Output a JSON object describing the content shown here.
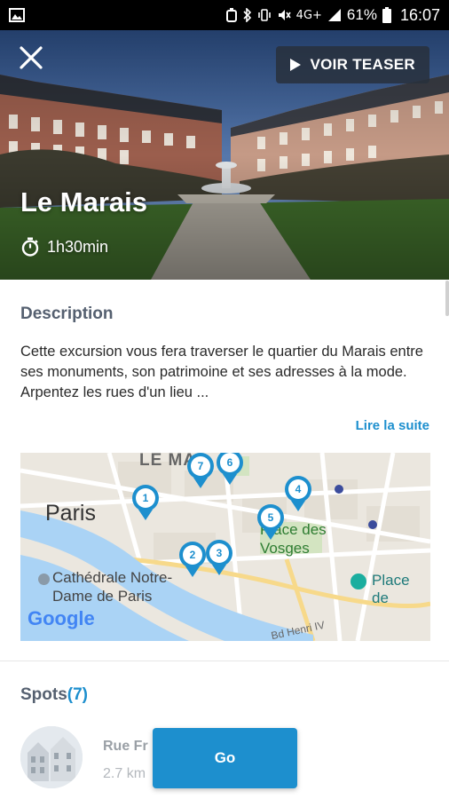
{
  "status_bar": {
    "battery": "61%",
    "time": "16:07",
    "network": "4G+",
    "icons": [
      "image-icon",
      "alarm-icon",
      "bluetooth-icon",
      "vibrate-icon",
      "mute-icon",
      "signal-icon",
      "battery-icon"
    ]
  },
  "hero": {
    "title": "Le Marais",
    "duration": "1h30min",
    "teaser_label": "VOIR TEASER",
    "close_icon": "close-icon",
    "timer_icon": "stopwatch-icon"
  },
  "description": {
    "heading": "Description",
    "text": "Cette excursion vous fera traverser le quartier du Marais entre ses monuments, son patrimoine et ses adresses à la mode. Arpentez les rues d'un lieu ...",
    "read_more": "Lire la suite"
  },
  "map": {
    "labels": {
      "marais": "LE MA",
      "paris": "Paris",
      "place_des_vosges": "Place des Vosges",
      "cathedrale": "Cathédrale Notre-Dame de Paris",
      "place_de": "Place de",
      "bd_henri": "Bd Henri IV",
      "google": "Google"
    },
    "pins": [
      "1",
      "2",
      "3",
      "4",
      "5",
      "6",
      "7"
    ]
  },
  "spots": {
    "heading": "Spots",
    "count": "(7)",
    "items": [
      {
        "name": "Rue Fr",
        "distance": "2.7 km"
      }
    ]
  },
  "go_button": "Go",
  "colors": {
    "accent": "#1d8fce",
    "heading": "#556070",
    "status_bar": "#000000"
  }
}
